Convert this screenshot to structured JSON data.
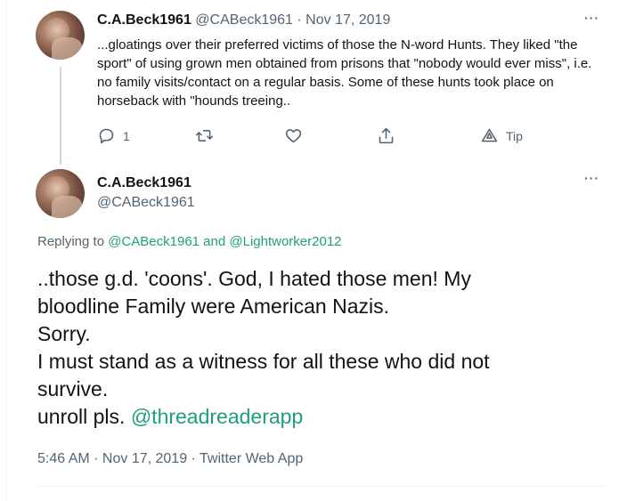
{
  "tweet1": {
    "display_name": "C.A.Beck1961",
    "handle": "@CABeck1961",
    "separator": "·",
    "date": "Nov 17, 2019",
    "body": "...gloatings over their preferred victims of those the N-word Hunts. They liked \"the sport\" of using grown men obtained from prisons that \"nobody would ever miss\", i.e. no family visits/contact on a regular basis. Some of these hunts took place on horseback with \"hounds treeing..",
    "reply_count": "1",
    "tip_label": "Tip",
    "more_label": "···",
    "icons": {
      "reply": "reply-icon",
      "retweet": "retweet-icon",
      "like": "heart-icon",
      "share": "share-icon",
      "tip": "tip-icon"
    }
  },
  "tweet2": {
    "display_name": "C.A.Beck1961",
    "handle": "@CABeck1961",
    "more_label": "···",
    "replying_prefix": "Replying to",
    "replying_user1": "@CABeck1961",
    "replying_and": "and",
    "replying_user2": "@Lightworker2012",
    "lines": [
      "..those g.d. 'coons'. God, I hated those men! My",
      "bloodline Family were American Nazis.",
      "Sorry.",
      "I must stand as a witness for all these who did not",
      "survive."
    ],
    "last_line_text": "unroll pls.",
    "mention": "@threadreaderapp",
    "timestamp": "5:46 AM · Nov 17, 2019 · Twitter Web App"
  },
  "colors": {
    "text": "#0f1419",
    "muted": "#536471",
    "link": "#1f9e7c",
    "thread_line": "#cfd9de"
  }
}
